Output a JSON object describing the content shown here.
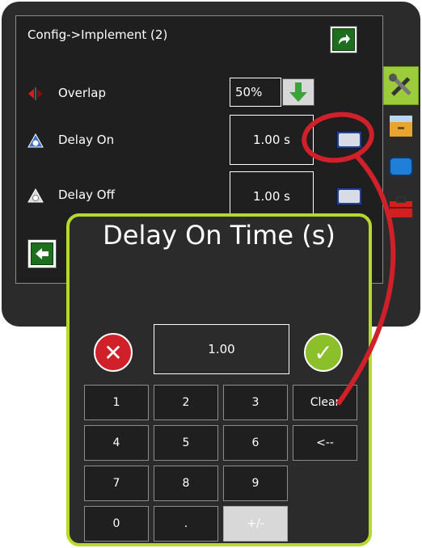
{
  "screen": {
    "title": "Config->Implement (2)",
    "rows": [
      {
        "label": "Overlap",
        "value": "50%",
        "icon": "overlap-icon"
      },
      {
        "label": "Delay On",
        "value": "1.00 s",
        "icon": "delay-on-icon"
      },
      {
        "label": "Delay Off",
        "value": "1.00 s",
        "icon": "delay-off-icon"
      }
    ]
  },
  "dialog": {
    "title": "Delay On Time (s)",
    "value": "1.00",
    "keys": [
      "1",
      "2",
      "3",
      "Clear",
      "4",
      "5",
      "6",
      "<--",
      "7",
      "8",
      "9",
      "0",
      ".",
      "+/-"
    ]
  },
  "colors": {
    "dialog_border": "#b6d92c",
    "callout": "#d0202a",
    "active_tab": "#9ccc3a"
  }
}
